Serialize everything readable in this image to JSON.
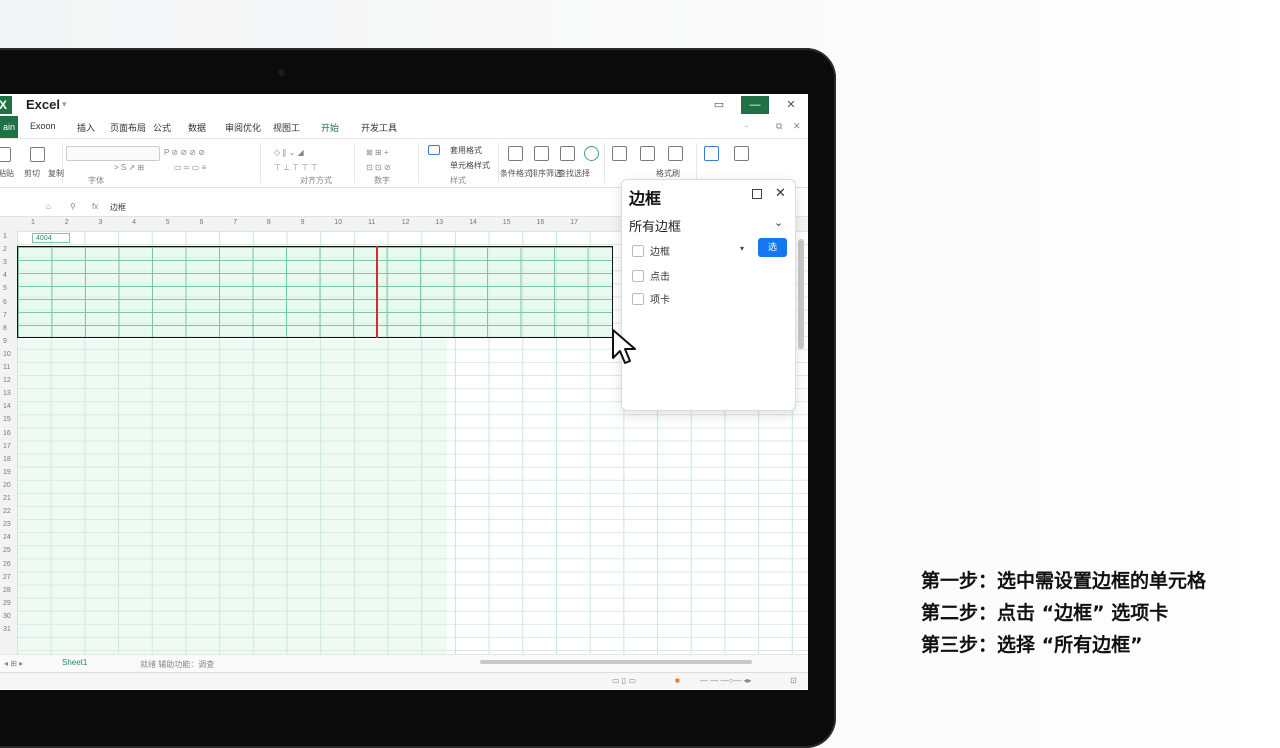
{
  "app": {
    "title": "Excel",
    "title_caret": "▾",
    "window_buttons": [
      "▭",
      "—",
      "✕"
    ]
  },
  "ribbon_tabs": {
    "file": "ain",
    "items": [
      "Exoon",
      "插入",
      "页面布局",
      "公式",
      "数据",
      "审阅优化",
      "视图工",
      "开始",
      "开发工具"
    ],
    "active_index": 7
  },
  "ribbon": {
    "left_labels": [
      "粘贴",
      "剪切",
      "复制"
    ],
    "group_labels": [
      "字体",
      "对齐方式",
      "数字",
      "样式",
      "条件格式",
      "排序筛选",
      "查找选择",
      "格式刷"
    ],
    "small_labels": [
      "套用格式",
      "单元格样式"
    ]
  },
  "formula_bar": {
    "namebox": "边框",
    "fx": "fx"
  },
  "columns": [
    "1",
    "2",
    "3",
    "4",
    "5",
    "6",
    "7",
    "8",
    "9",
    "10",
    "11",
    "12",
    "13",
    "14",
    "15",
    "16",
    "17"
  ],
  "rows": [
    "1",
    "2",
    "3",
    "4",
    "5",
    "6",
    "7",
    "8",
    "9",
    "10",
    "11",
    "12",
    "13",
    "14",
    "15",
    "16",
    "17",
    "18",
    "19",
    "20",
    "21",
    "22",
    "23",
    "24",
    "25",
    "26",
    "27",
    "28",
    "29",
    "30",
    "31"
  ],
  "cell_a1": "4004",
  "sheet": {
    "tab_label": "Sheet1",
    "status_text": "就绪  辅助功能：调查"
  },
  "border_panel": {
    "title": "边框",
    "selected": "所有边框",
    "option_1": "边框",
    "apply_button": "选",
    "option_2": "点击",
    "option_3": "项卡"
  },
  "instructions": [
    "第一步：选中需设置边框的单元格",
    "第二步：点击 “边框” 选项卡",
    "第三步：选择 “所有边框”"
  ]
}
